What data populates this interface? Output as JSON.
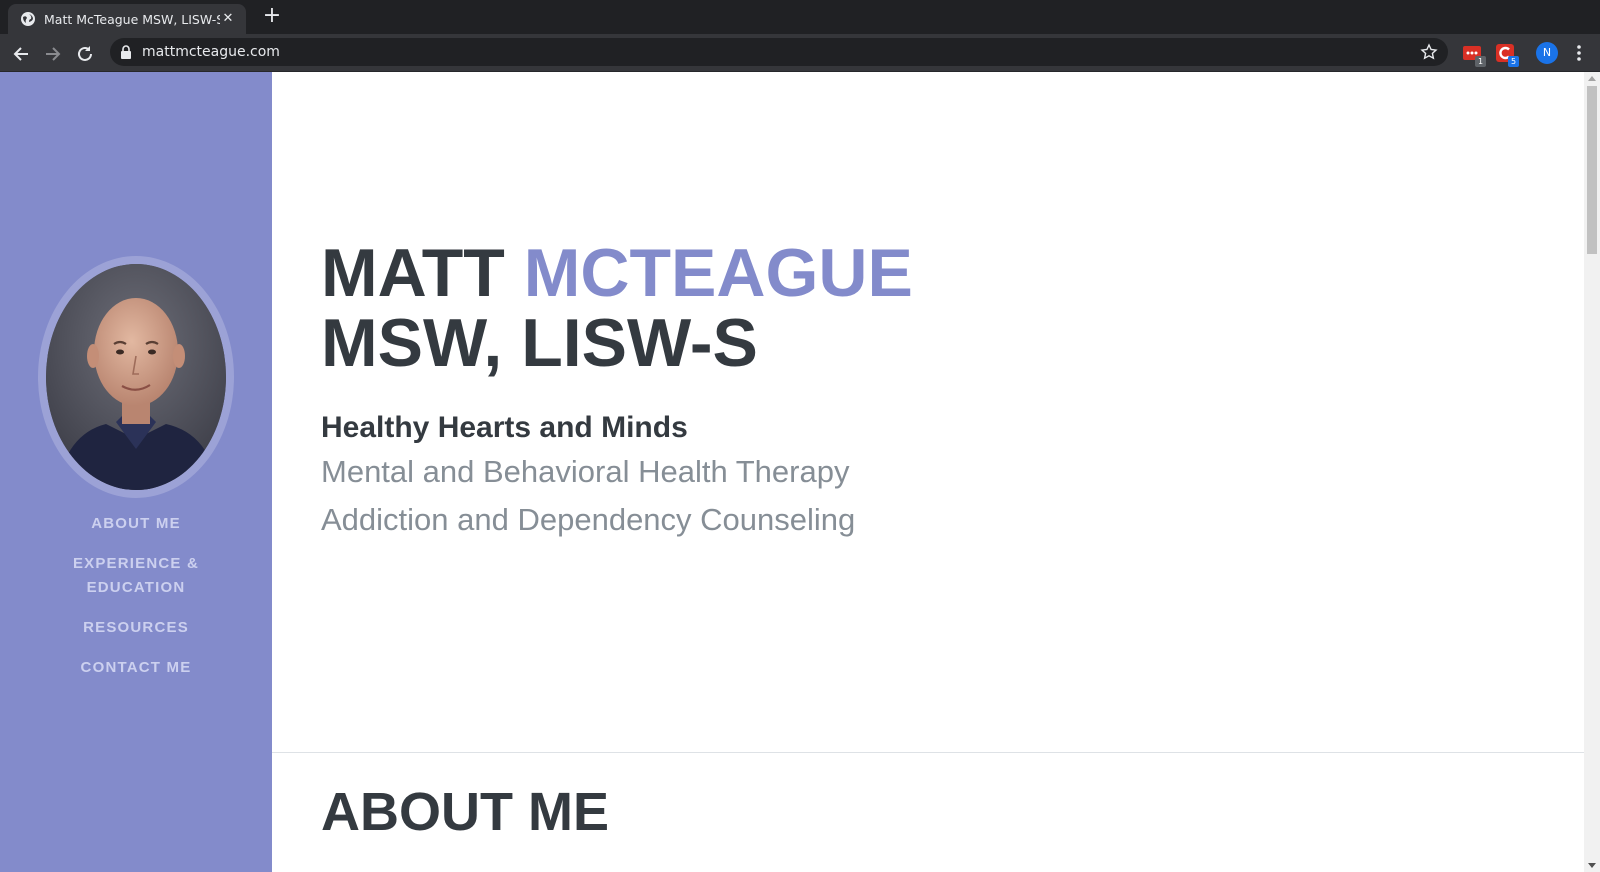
{
  "browser": {
    "tab_title": "Matt McTeague MSW, LISW-S",
    "new_tab_label": "+",
    "url": "mattmcteague.com",
    "extensions": [
      {
        "icon": "extension-todo-icon",
        "badge": "1",
        "badge_color": "#5f6368",
        "color": "#d93025"
      },
      {
        "icon": "extension-c-icon",
        "badge": "5",
        "badge_color": "#1a73e8",
        "color": "#d93025"
      }
    ],
    "profile_initial": "N"
  },
  "sidebar": {
    "background": "#838bcb",
    "nav": [
      {
        "label": "ABOUT ME"
      },
      {
        "label": "EXPERIENCE & EDUCATION"
      },
      {
        "label": "RESOURCES"
      },
      {
        "label": "CONTACT ME"
      }
    ]
  },
  "hero": {
    "first_name": "MATT",
    "last_name": "MCTEAGUE",
    "credentials": "MSW, LISW-S",
    "subheading": "Healthy Hearts and Minds",
    "lines": [
      "Mental and Behavioral Health Therapy",
      "Addiction and Dependency Counseling"
    ],
    "accent_color": "#838bcb"
  },
  "about": {
    "title": "ABOUT ME"
  }
}
